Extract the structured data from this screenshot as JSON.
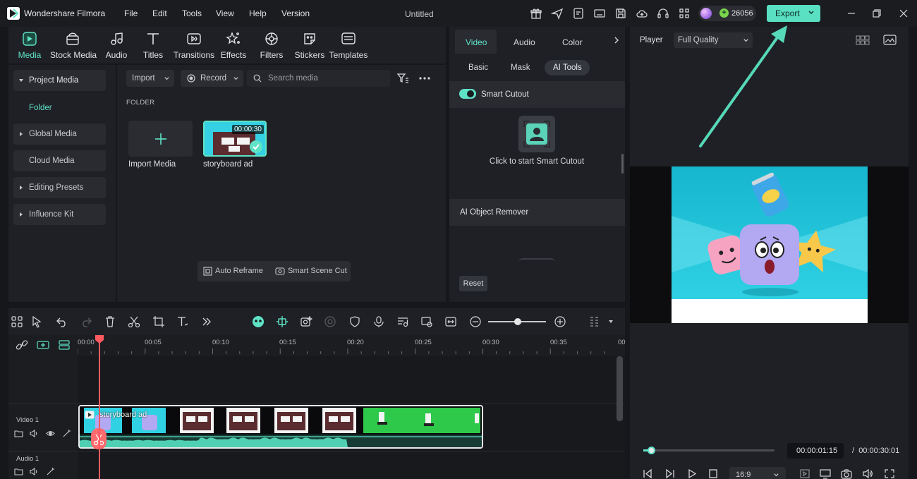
{
  "app": {
    "name": "Wondershare Filmora",
    "menu": [
      "File",
      "Edit",
      "Tools",
      "View",
      "Help",
      "Version"
    ],
    "document_title": "Untitled",
    "credits": "26056",
    "export_label": "Export"
  },
  "media_tabs": [
    {
      "label": "Media",
      "icon": "media-icon",
      "active": true
    },
    {
      "label": "Stock Media",
      "icon": "stock-media-icon"
    },
    {
      "label": "Audio",
      "icon": "music-note-icon"
    },
    {
      "label": "Titles",
      "icon": "titles-icon"
    },
    {
      "label": "Transitions",
      "icon": "transitions-icon"
    },
    {
      "label": "Effects",
      "icon": "effects-icon"
    },
    {
      "label": "Filters",
      "icon": "filters-icon"
    },
    {
      "label": "Stickers",
      "icon": "stickers-icon"
    },
    {
      "label": "Templates",
      "icon": "templates-icon"
    }
  ],
  "sidebar": {
    "items": [
      {
        "label": "Project Media",
        "expanded": true
      },
      {
        "label": "Global Media"
      },
      {
        "label": "Cloud Media"
      },
      {
        "label": "Editing Presets"
      },
      {
        "label": "Influence Kit"
      }
    ],
    "sub_item": "Folder"
  },
  "media_toolbar": {
    "import_label": "Import",
    "record_label": "Record",
    "search_placeholder": "Search media"
  },
  "media_library": {
    "folder_heading": "FOLDER",
    "import_tile_label": "Import Media",
    "clip": {
      "name": "storyboard ad",
      "duration": "00:00:30"
    }
  },
  "media_bottom": {
    "auto_reframe": "Auto Reframe",
    "smart_scene_cut": "Smart Scene Cut"
  },
  "properties": {
    "tabs": [
      "Video",
      "Audio",
      "Color"
    ],
    "active_tab": "Video",
    "subtabs": [
      "Basic",
      "Mask",
      "AI Tools"
    ],
    "active_subtab": "AI Tools",
    "smart_cutout_label": "Smart Cutout",
    "smart_cutout_enabled": true,
    "cutout_hint": "Click to start Smart Cutout",
    "ai_object_remover": "AI Object Remover",
    "reset_label": "Reset"
  },
  "player": {
    "label": "Player",
    "quality": "Full Quality",
    "current_time": "00:00:01:15",
    "separator": "/",
    "total_time": "00:00:30:01",
    "aspect_ratio": "16:9",
    "progress": 0.05
  },
  "timeline": {
    "ruler": [
      "00:00",
      "00:05",
      "00:10",
      "00:15",
      "00:20",
      "00:25",
      "00:30",
      "00:35",
      "00"
    ],
    "tracks": [
      {
        "label": "Video 1"
      },
      {
        "label": "Audio 1"
      }
    ],
    "clip_name": "storyboard ad"
  },
  "colors": {
    "accent": "#5ee3c6",
    "playhead": "#ff5a5f",
    "panel": "#1f2025",
    "background": "#16171b",
    "annotation_arrow": "#56d9b8"
  }
}
